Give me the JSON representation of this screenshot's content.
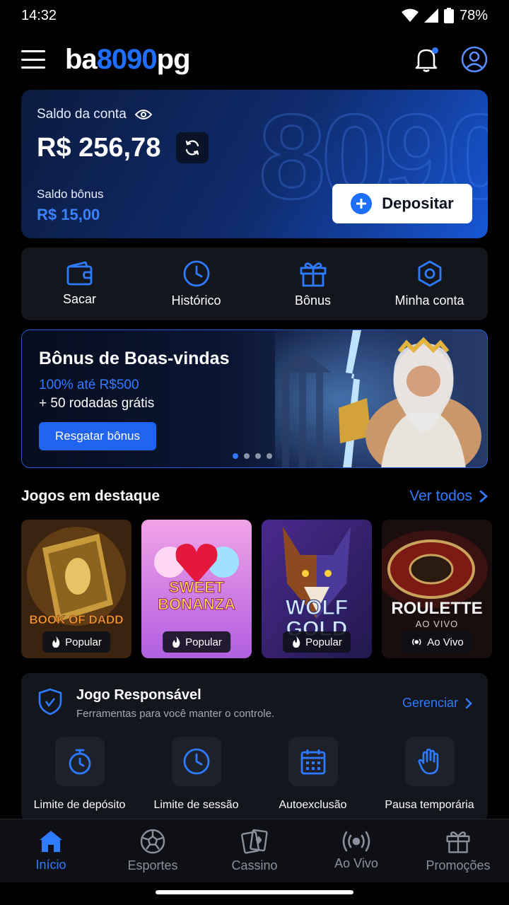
{
  "status_bar": {
    "time": "14:32",
    "battery": "78%"
  },
  "header": {
    "brand_part1": "ba",
    "brand_part2": "8090",
    "brand_part3": "pg",
    "icons": [
      "menu-icon",
      "bell-icon",
      "user-icon"
    ]
  },
  "balance": {
    "label": "Saldo da conta",
    "amount": "R$ 256,78",
    "bonus_label": "Saldo bônus",
    "bonus_amount": "R$ 15,00",
    "deposit_label": "Depositar",
    "watermark": "8090"
  },
  "quick_actions": [
    {
      "label": "Sacar",
      "icon": "wallet-icon"
    },
    {
      "label": "Histórico",
      "icon": "clock-icon"
    },
    {
      "label": "Bônus",
      "icon": "gift-icon"
    },
    {
      "label": "Minha conta",
      "icon": "settings-icon"
    }
  ],
  "banner": {
    "title": "Bônus de Boas-vindas",
    "line1": "100% até R$500",
    "line2": "+ 50 rodadas grátis",
    "button": "Resgatar bônus",
    "slides": 4,
    "active_slide": 1
  },
  "featured": {
    "title": "Jogos em destaque",
    "see_all": "Ver todos",
    "games": [
      {
        "name": "BOOK OF DADD",
        "tag": "Popular",
        "tag_icon": "flame-icon"
      },
      {
        "name": "SWEET BONANZA",
        "tag": "Popular",
        "tag_icon": "flame-icon"
      },
      {
        "name": "WOLF GOLD",
        "tag": "Popular",
        "tag_icon": "flame-icon"
      },
      {
        "name": "ROULETTE",
        "subname": "AO VIVO",
        "tag": "Ao Vivo",
        "tag_icon": "live-icon"
      }
    ]
  },
  "responsible": {
    "title": "Jogo Responsável",
    "subtitle": "Ferramentas para você manter o controle.",
    "manage": "Gerenciar",
    "tools": [
      {
        "label": "Limite de depósito",
        "icon": "stopwatch-icon"
      },
      {
        "label": "Limite de sessão",
        "icon": "clock-icon"
      },
      {
        "label": "Autoexclusão",
        "icon": "calendar-icon"
      },
      {
        "label": "Pausa temporária",
        "icon": "hand-icon"
      }
    ]
  },
  "bottom_nav": [
    {
      "label": "Início",
      "icon": "home-icon",
      "active": true
    },
    {
      "label": "Esportes",
      "icon": "soccer-ball-icon",
      "active": false
    },
    {
      "label": "Cassino",
      "icon": "cards-icon",
      "active": false
    },
    {
      "label": "Ao Vivo",
      "icon": "live-icon",
      "active": false
    },
    {
      "label": "Promoções",
      "icon": "gift-icon",
      "active": false
    }
  ],
  "colors": {
    "accent": "#1f6fff",
    "background": "#000000",
    "card": "#14161d"
  }
}
